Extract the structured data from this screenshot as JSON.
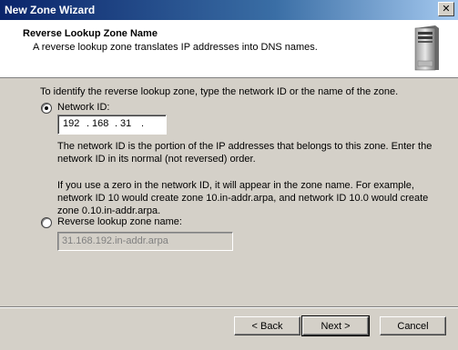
{
  "window": {
    "title": "New Zone Wizard",
    "close_label": "✕"
  },
  "header": {
    "title": "Reverse Lookup Zone Name",
    "subtitle": "A reverse lookup zone translates IP addresses into DNS names.",
    "icon": "server-icon"
  },
  "main": {
    "instruction": "To identify the reverse lookup zone, type the network ID or the name of the zone.",
    "network_id": {
      "label": "Network ID:",
      "selected": true,
      "octets": [
        "192",
        "168",
        "31",
        ""
      ]
    },
    "description_1_line1": "The network ID is the portion of the IP addresses that belongs to this zone. Enter the",
    "description_1_line2": "network ID in its normal (not reversed) order.",
    "description_2_line1": "If you use a zero in the network ID, it will appear in the zone name. For example,",
    "description_2_line2": "network ID 10 would create zone 10.in-addr.arpa, and network ID 10.0 would create",
    "description_2_line3": "zone 0.10.in-addr.arpa.",
    "reverse_zone": {
      "label": "Reverse lookup zone name:",
      "selected": false,
      "value": "31.168.192.in-addr.arpa"
    }
  },
  "buttons": {
    "back": "< Back",
    "next": "Next >",
    "cancel": "Cancel"
  }
}
